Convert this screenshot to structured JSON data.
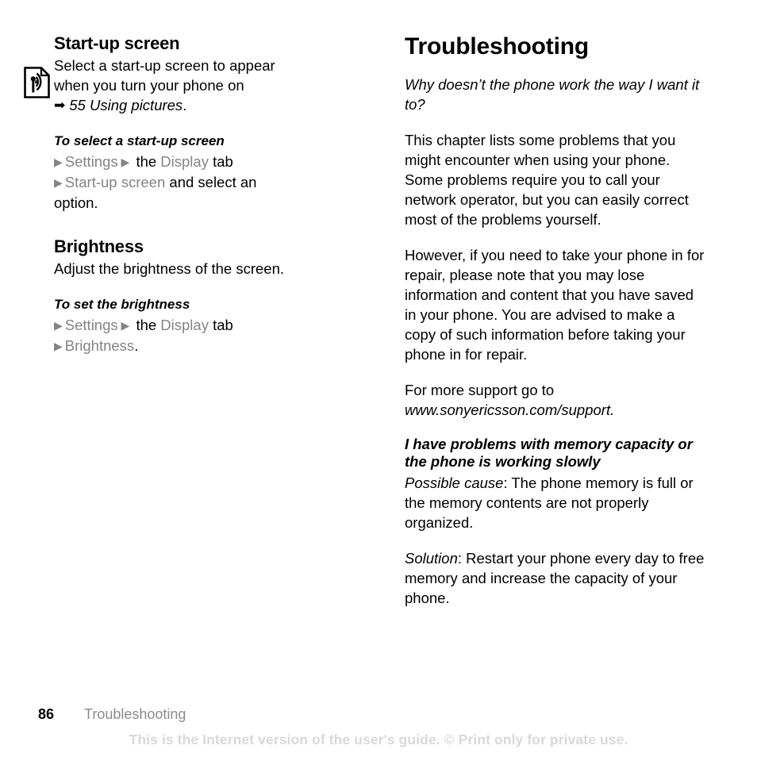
{
  "document": {
    "type": "user-guide-page",
    "page_number": "86",
    "footer_chapter": "Troubleshooting",
    "watermark": "This is the Internet version of the user's guide. © Print only for private use."
  },
  "left_column": {
    "note_icon": "page-with-signal-waves-icon",
    "sections": [
      {
        "heading": "Start-up screen",
        "intro_line1": "Select a start-up screen to appear",
        "intro_line2": "when you turn your phone on",
        "crossref_arrow": "➡",
        "crossref_text": "55 Using pictures",
        "crossref_period": ".",
        "procedure_title": "To select a start-up screen",
        "steps": [
          {
            "bullet": "▶",
            "parts": [
              {
                "text": "Settings",
                "style": "menu"
              },
              {
                "text": " ▶ ",
                "style": "menu-arrow"
              },
              {
                "text": "the ",
                "style": "plain"
              },
              {
                "text": "Display",
                "style": "menu"
              },
              {
                "text": " tab",
                "style": "plain"
              }
            ]
          },
          {
            "bullet": "▶",
            "parts": [
              {
                "text": "Start-up screen",
                "style": "menu"
              },
              {
                "text": " and select an",
                "style": "plain"
              }
            ]
          },
          {
            "bullet": "",
            "parts": [
              {
                "text": "option.",
                "style": "plain"
              }
            ]
          }
        ]
      },
      {
        "heading": "Brightness",
        "intro_line1": "Adjust the brightness of the screen.",
        "procedure_title": "To set the brightness",
        "steps": [
          {
            "bullet": "▶",
            "parts": [
              {
                "text": "Settings",
                "style": "menu"
              },
              {
                "text": " ▶ ",
                "style": "menu-arrow"
              },
              {
                "text": "the ",
                "style": "plain"
              },
              {
                "text": "Display",
                "style": "menu"
              },
              {
                "text": " tab",
                "style": "plain"
              }
            ]
          },
          {
            "bullet": "▶",
            "parts": [
              {
                "text": "Brightness",
                "style": "menu"
              },
              {
                "text": ".",
                "style": "plain"
              }
            ]
          }
        ]
      }
    ]
  },
  "right_column": {
    "chapter_title": "Troubleshooting",
    "question": "Why doesn’t the phone work the way I want it to?",
    "paragraph_1": "This chapter lists some problems that you might encounter when using your phone. Some problems require you to call your network operator, but you can easily correct most of the problems yourself.",
    "paragraph_2": "However, if you need to take your phone in for repair, please note that you may lose information and content that you have saved in your phone. You are advised to make a copy of such information before taking your phone in for repair.",
    "support_lead": "For more support go to",
    "support_url": "www.sonyericsson.com/support",
    "support_period": ".",
    "issue_heading": "I have problems with memory capacity or the phone is working slowly",
    "cause_label": "Possible cause",
    "cause_text": ": The phone memory is full or the memory contents are not properly organized.",
    "solution_label": "Solution",
    "solution_text": ": Restart your phone every day to free memory and increase the capacity of your phone."
  },
  "colors": {
    "text": "#000000",
    "menu_gray": "#848484",
    "footer_gray": "#8c8c8c",
    "watermark_gray": "#d9d9d9",
    "background": "#ffffff"
  }
}
